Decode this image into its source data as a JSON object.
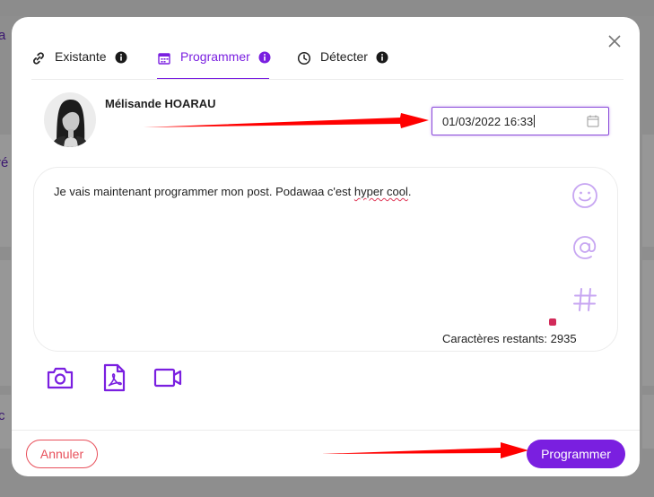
{
  "background": {
    "fragments": [
      "a",
      "ré",
      "c"
    ]
  },
  "modal": {
    "close_icon": "close-icon",
    "tabs": [
      {
        "label": "Existante",
        "icon": "link-icon",
        "active": false
      },
      {
        "label": "Programmer",
        "icon": "calendar-icon",
        "active": true
      },
      {
        "label": "Détecter",
        "icon": "clock-icon",
        "active": false
      }
    ],
    "user": {
      "name": "Mélisande HOARAU",
      "avatar": "avatar"
    },
    "schedule": {
      "date_value": "01/03/2022 16:33",
      "icon": "calendar-icon"
    },
    "editor": {
      "text_before": "Je vais maintenant programmer mon post. Podawaa c'est ",
      "text_underlined": "hyper cool",
      "text_after": ".",
      "tools": [
        "emoji-icon",
        "mention-icon",
        "hashtag-icon"
      ],
      "chars_remaining": "Caractères restants: 2935"
    },
    "media": [
      "camera-icon",
      "pdf-icon",
      "video-icon"
    ],
    "footer": {
      "cancel_label": "Annuler",
      "submit_label": "Programmer"
    }
  },
  "colors": {
    "accent": "#7a1fe0",
    "cancel": "#e8505b",
    "annotation_arrow": "#ff0000"
  }
}
